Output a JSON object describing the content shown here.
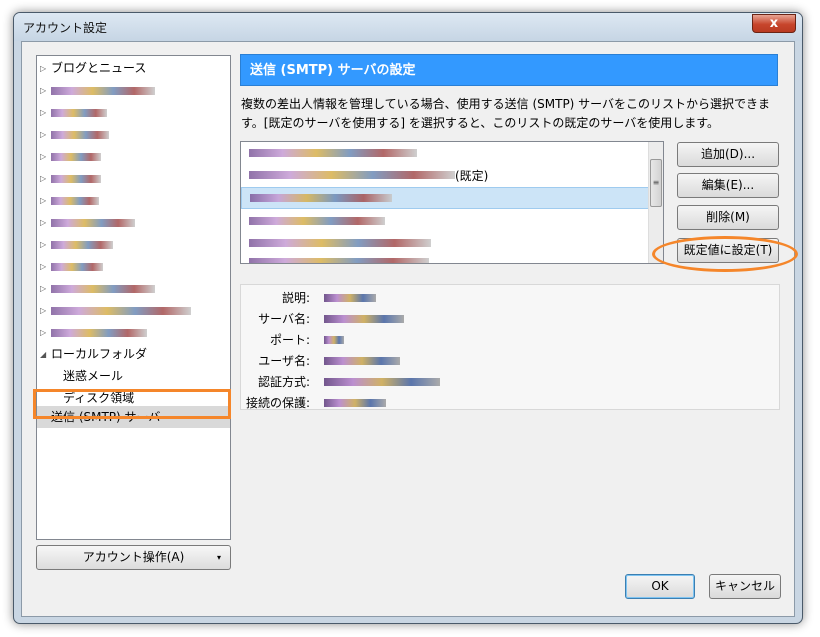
{
  "window": {
    "title": "アカウント設定",
    "close_symbol": "x"
  },
  "tree": {
    "items": [
      {
        "label": "ブログとニュース",
        "arrow": "▷"
      },
      {
        "label": "",
        "arrow": "▷"
      },
      {
        "label": "",
        "arrow": "▷"
      },
      {
        "label": "",
        "arrow": "▷"
      },
      {
        "label": "",
        "arrow": "▷"
      },
      {
        "label": "",
        "arrow": "▷"
      },
      {
        "label": "",
        "arrow": "▷"
      },
      {
        "label": "",
        "arrow": "▷"
      },
      {
        "label": "",
        "arrow": "▷"
      },
      {
        "label": "",
        "arrow": "▷"
      },
      {
        "label": "",
        "arrow": "▷"
      },
      {
        "label": "",
        "arrow": "▷"
      },
      {
        "label": "",
        "arrow": "▷"
      },
      {
        "label": "ローカルフォルダ",
        "arrow": "◢"
      },
      {
        "label": "迷惑メール",
        "arrow": ""
      },
      {
        "label": "ディスク領域",
        "arrow": ""
      },
      {
        "label": "送信 (SMTP) サーバ",
        "arrow": ""
      }
    ]
  },
  "account_actions": {
    "label": "アカウント操作(A)",
    "arrow": "▾"
  },
  "panel": {
    "title": "送信 (SMTP) サーバの設定",
    "description_line1": "複数の差出人情報を管理している場合、使用する送信 (SMTP) サーバをこのリストから選択できま",
    "description_line2": "す。[既定のサーバを使用する] を選択すると、このリストの既定のサーバを使用します。",
    "default_tag": "(既定)",
    "scroll_grip": "≡"
  },
  "buttons": {
    "add": "追加(D)...",
    "edit": "編集(E)...",
    "delete": "削除(M)",
    "set_default": "既定値に設定(T)",
    "ok": "OK",
    "cancel": "キャンセル"
  },
  "details": {
    "description": "説明:",
    "server_name": "サーバ名:",
    "port": "ポート:",
    "username": "ユーザ名:",
    "auth_method": "認証方式:",
    "connection_security": "接続の保護:"
  }
}
